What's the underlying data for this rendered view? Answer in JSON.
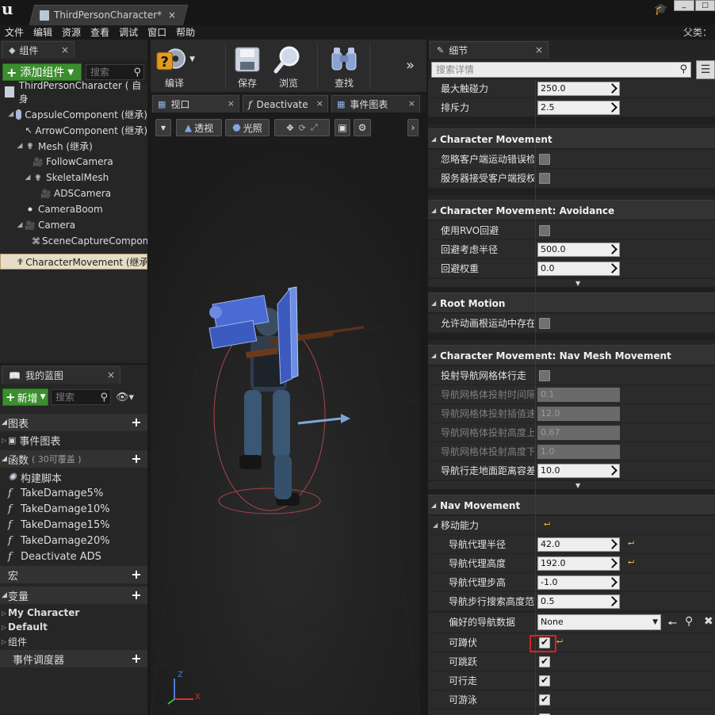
{
  "window": {
    "tab_title": "ThirdPersonCharacter*",
    "tab_close": "×",
    "parent_class_label": "父类："
  },
  "menu": [
    "文件",
    "编辑",
    "资源",
    "查看",
    "调试",
    "窗口",
    "帮助"
  ],
  "components_panel": {
    "tab": "组件",
    "add_label": "添加组件",
    "search_placeholder": "搜索",
    "root": "ThirdPersonCharacter ( 自身",
    "tree": [
      {
        "label": "CapsuleComponent (继承)",
        "icon": "capsule-icon"
      },
      {
        "label": "ArrowComponent (继承)",
        "icon": "arrow-icon"
      },
      {
        "label": "Mesh (继承)",
        "icon": "mesh-icon"
      },
      {
        "label": "FollowCamera",
        "icon": "camera-icon"
      },
      {
        "label": "SkeletalMesh",
        "icon": "skeletal-mesh-icon"
      },
      {
        "label": "ADSCamera",
        "icon": "camera-icon"
      },
      {
        "label": "CameraBoom",
        "icon": "spring-arm-icon"
      },
      {
        "label": "Camera",
        "icon": "camera-icon"
      },
      {
        "label": "SceneCaptureCompone",
        "icon": "scene-capture-icon"
      },
      {
        "label": "CharacterMovement (继承)",
        "icon": "character-movement-icon"
      }
    ]
  },
  "blueprint_panel": {
    "tab": "我的蓝图",
    "new_label": "新增",
    "search_placeholder": "搜索",
    "graphs_label": "图表",
    "event_graph_label": "事件图表",
    "functions_label": "函数",
    "functions_count": "( 30可覆盖 )",
    "functions": [
      "构建脚本",
      "TakeDamage5%",
      "TakeDamage10%",
      "TakeDamage15%",
      "TakeDamage20%",
      "Deactivate ADS"
    ],
    "macros_label": "宏",
    "variables_label": "变量",
    "variable_groups": [
      "My Character",
      "Default",
      "组件"
    ],
    "event_dispatchers_label": "事件调度器"
  },
  "toolbar": {
    "compile": "编译",
    "save": "保存",
    "browse": "浏览",
    "find": "查找",
    "overflow": "»"
  },
  "viewport_tabs": {
    "viewport": "视口",
    "deactivate": "Deactivate",
    "event_graph": "事件图表"
  },
  "viewport_toolbar": {
    "perspective": "透视",
    "lit": "光照"
  },
  "viewport_gizmo": {
    "z": "Z",
    "x": "X"
  },
  "details_panel": {
    "tab": "细节",
    "search_placeholder": "搜索详情",
    "top_rows": [
      {
        "label": "最大触碰力",
        "value": "250.0"
      },
      {
        "label": "排斥力",
        "value": "2.5"
      }
    ],
    "categories": {
      "character_movement": "Character Movement",
      "avoidance": "Character Movement: Avoidance",
      "root_motion": "Root Motion",
      "nav_mesh_movement": "Character Movement: Nav Mesh Movement",
      "nav_movement": "Nav Movement"
    },
    "character_movement_rows": [
      {
        "label": "忽略客户端运动错误检查",
        "checked": false
      },
      {
        "label": "服务器接受客户端授权位",
        "checked": false
      }
    ],
    "avoidance_rows": {
      "use_rvo": {
        "label": "使用RVO回避",
        "checked": false
      },
      "consideration_radius": {
        "label": "回避考虑半径",
        "value": "500.0"
      },
      "weight": {
        "label": "回避权重",
        "value": "0.0"
      }
    },
    "root_motion_row": {
      "label": "允许动画根运动中存在物",
      "checked": false
    },
    "nav_mesh_rows": {
      "project_nav": {
        "label": "投射导航网格体行走",
        "checked": false
      },
      "interval": {
        "label": "导航网格体投射时间隔",
        "value": "0.1"
      },
      "interp_speed": {
        "label": "导航网格体投射插值速度",
        "value": "12.0"
      },
      "height_up": {
        "label": "导航网格体投射高度上线",
        "value": "0.67"
      },
      "height_down": {
        "label": "导航网格体投射高度下线",
        "value": "1.0"
      },
      "floor_tolerance": {
        "label": "导航行走地面距离容差",
        "value": "10.0"
      }
    },
    "nav_movement": {
      "capability_label": "移动能力",
      "agent_radius": {
        "label": "导航代理半径",
        "value": "42.0"
      },
      "agent_height": {
        "label": "导航代理高度",
        "value": "192.0"
      },
      "agent_step": {
        "label": "导航代理步高",
        "value": "-1.0"
      },
      "step_search": {
        "label": "导航步行搜索高度范围",
        "value": "0.5"
      },
      "preferred_nav": {
        "label": "偏好的导航数据",
        "value": "None"
      },
      "can_crouch": {
        "label": "可蹲伏",
        "checked": true
      },
      "can_jump": {
        "label": "可跳跃",
        "checked": true
      },
      "can_walk": {
        "label": "可行走",
        "checked": true
      },
      "can_swim": {
        "label": "可游泳",
        "checked": true
      }
    }
  },
  "colors": {
    "accent_green": "#3b8e2e",
    "selection": "#e7dcc5",
    "highlight_red": "#e02020",
    "reset_yellow": "#e8c23a"
  }
}
